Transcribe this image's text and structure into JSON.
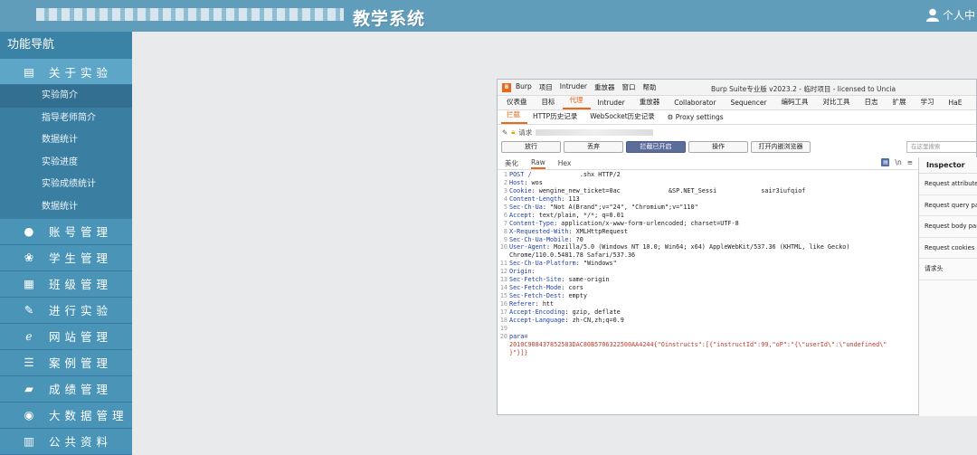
{
  "header": {
    "title": "教学系统",
    "user_label": "个人中"
  },
  "sidebar": {
    "nav_title": "功能导航",
    "modules": [
      {
        "label": "关于实验",
        "icon": "document-icon",
        "open": true
      },
      {
        "label": "账号管理",
        "icon": "user-icon"
      },
      {
        "label": "学生管理",
        "icon": "users-icon"
      },
      {
        "label": "班级管理",
        "icon": "printer-icon"
      },
      {
        "label": "进行实验",
        "icon": "edit-icon"
      },
      {
        "label": "网站管理",
        "icon": "ie-icon"
      },
      {
        "label": "案例管理",
        "icon": "list-icon"
      },
      {
        "label": "成绩管理",
        "icon": "folder-icon"
      },
      {
        "label": "大数据管理",
        "icon": "globe-icon"
      },
      {
        "label": "公共资料",
        "icon": "file-icon"
      }
    ],
    "sub_items": [
      "实验简介",
      "指导老师简介",
      "数据统计",
      "实验进度",
      "实验成绩统计",
      "数据统计"
    ]
  },
  "burp": {
    "logo": "B",
    "menus": [
      "Burp",
      "项目",
      "Intruder",
      "重放器",
      "窗口",
      "帮助"
    ],
    "window_title": "Burp Suite专业版  v2023.2 - 临时项目 - licensed to Uncia",
    "tabs_main": [
      "仪表盘",
      "目标",
      "代理",
      "Intruder",
      "重放器",
      "Collaborator",
      "Sequencer",
      "编码工具",
      "对比工具",
      "日志",
      "扩展",
      "学习",
      "HaE"
    ],
    "tabs_proxy": [
      "拦截",
      "HTTP历史记录",
      "WebSocket历史记录",
      "Proxy settings"
    ],
    "request_label": "请求",
    "buttons": [
      "放行",
      "丢弃",
      "拦截已开启",
      "操作",
      "打开内嵌浏览器"
    ],
    "search_placeholder": "在这里搜索",
    "view_tabs": [
      "美化",
      "Raw",
      "Hex"
    ],
    "view_icon_n": "\\n",
    "view_icon_menu": "≡",
    "inspector_title": "Inspector",
    "inspector_rows": [
      "Request attributes",
      "Request query para",
      "Request body para",
      "Request cookies",
      "请求头"
    ]
  },
  "request_lines": [
    {
      "n": "1",
      "k": "POST /",
      "v": "             .shx HTTP/2"
    },
    {
      "n": "2",
      "k": "Host",
      "v": ": wos"
    },
    {
      "n": "3",
      "k": "Cookie",
      "v": ": wengine_new_ticket=0ac             &SP.NET_Sessi            sair3iufqiof"
    },
    {
      "n": "4",
      "k": "Content-Length",
      "v": ": 113"
    },
    {
      "n": "5",
      "k": "Sec-Ch-Ua",
      "v": ": \"Not A(Brand\";v=\"24\", \"Chromium\";v=\"110\""
    },
    {
      "n": "6",
      "k": "Accept",
      "v": ": text/plain, */*; q=0.01"
    },
    {
      "n": "7",
      "k": "Content-Type",
      "v": ": application/x-www-form-urlencoded; charset=UTF-8"
    },
    {
      "n": "8",
      "k": "X-Requested-With",
      "v": ": XMLHttpRequest"
    },
    {
      "n": "9",
      "k": "Sec-Ch-Ua-Mobile",
      "v": ": ?0"
    },
    {
      "n": "10",
      "k": "User-Agent",
      "v": ": Mozilla/5.0 (Windows NT 10.0; Win64; x64) AppleWebKit/537.36 (KHTML, like Gecko)"
    },
    {
      "n": "",
      "k": "",
      "v": "Chrome/110.0.5481.78 Safari/537.36"
    },
    {
      "n": "11",
      "k": "Sec-Ch-Ua-Platform",
      "v": ": \"Windows\""
    },
    {
      "n": "12",
      "k": "Origin",
      "v": ":"
    },
    {
      "n": "13",
      "k": "Sec-Fetch-Site",
      "v": ": same-origin"
    },
    {
      "n": "14",
      "k": "Sec-Fetch-Mode",
      "v": ": cors"
    },
    {
      "n": "15",
      "k": "Sec-Fetch-Dest",
      "v": ": empty"
    },
    {
      "n": "16",
      "k": "Referer",
      "v": ": htt"
    },
    {
      "n": "17",
      "k": "Accept-Encoding",
      "v": ": gzip, deflate"
    },
    {
      "n": "18",
      "k": "Accept-Language",
      "v": ": zh-CN,zh;q=0.9"
    },
    {
      "n": "19",
      "k": "",
      "v": ""
    },
    {
      "n": "20",
      "k": "para",
      "v": "="
    },
    {
      "n": "",
      "k": "",
      "v": "2010C908437852583DAC80B5706322500AA4244{\"Oinstructs\":[{\"instructId\":99,\"oP\":\"{\\\"userId\\\":\\\"undefined\\\"",
      "red": true
    },
    {
      "n": "",
      "k": "",
      "v": "}\"}]}",
      "red": true
    }
  ],
  "colors": {
    "header": "#5f9dbb",
    "sidebar": "#3f88ad",
    "burp_accent": "#e8691c",
    "intercept_on": "#5d6d9b"
  }
}
